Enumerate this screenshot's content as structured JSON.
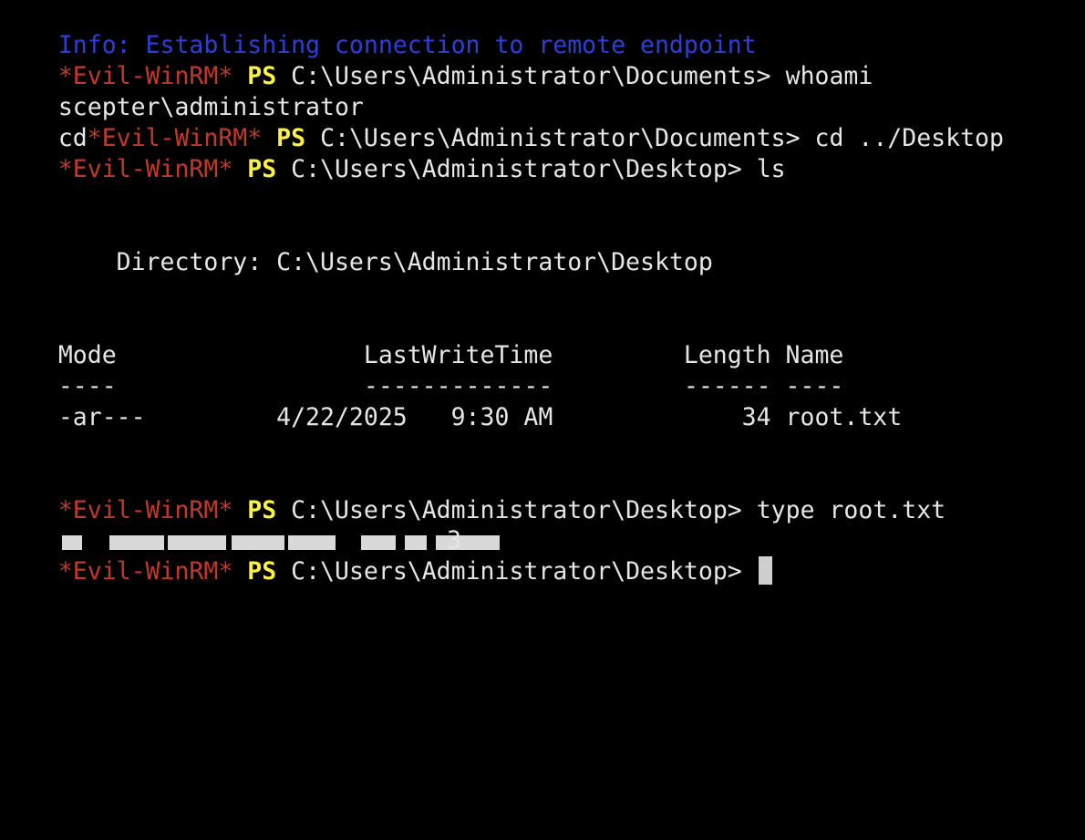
{
  "terminal": {
    "info_line": "Info: Establishing connection to remote endpoint",
    "prompt_prefix": "*Evil-WinRM*",
    "ps_label": "PS",
    "lines": {
      "l1_path": "C:\\Users\\Administrator\\Documents>",
      "l1_cmd": "whoami",
      "l2_output": "scepter\\administrator",
      "l3_stray": "cd",
      "l3_path": "C:\\Users\\Administrator\\Documents>",
      "l3_cmd": "cd ../Desktop",
      "l4_path": "C:\\Users\\Administrator\\Desktop>",
      "l4_cmd": "ls",
      "directory_line": "    Directory: C:\\Users\\Administrator\\Desktop",
      "header_row": "Mode                 LastWriteTime         Length Name",
      "separator_row": "----                 -------------         ------ ----",
      "file_row": "-ar---         4/22/2025   9:30 AM             34 root.txt",
      "l5_path": "C:\\Users\\Administrator\\Desktop>",
      "l5_cmd": "type root.txt",
      "redacted_tail": "3",
      "l6_path": "C:\\Users\\Administrator\\Desktop>"
    }
  },
  "colors": {
    "background": "#000000",
    "info": "#2b40d6",
    "evil_winrm": "#c0392b",
    "ps": "#fbf23f",
    "text": "#e6e6e6"
  }
}
